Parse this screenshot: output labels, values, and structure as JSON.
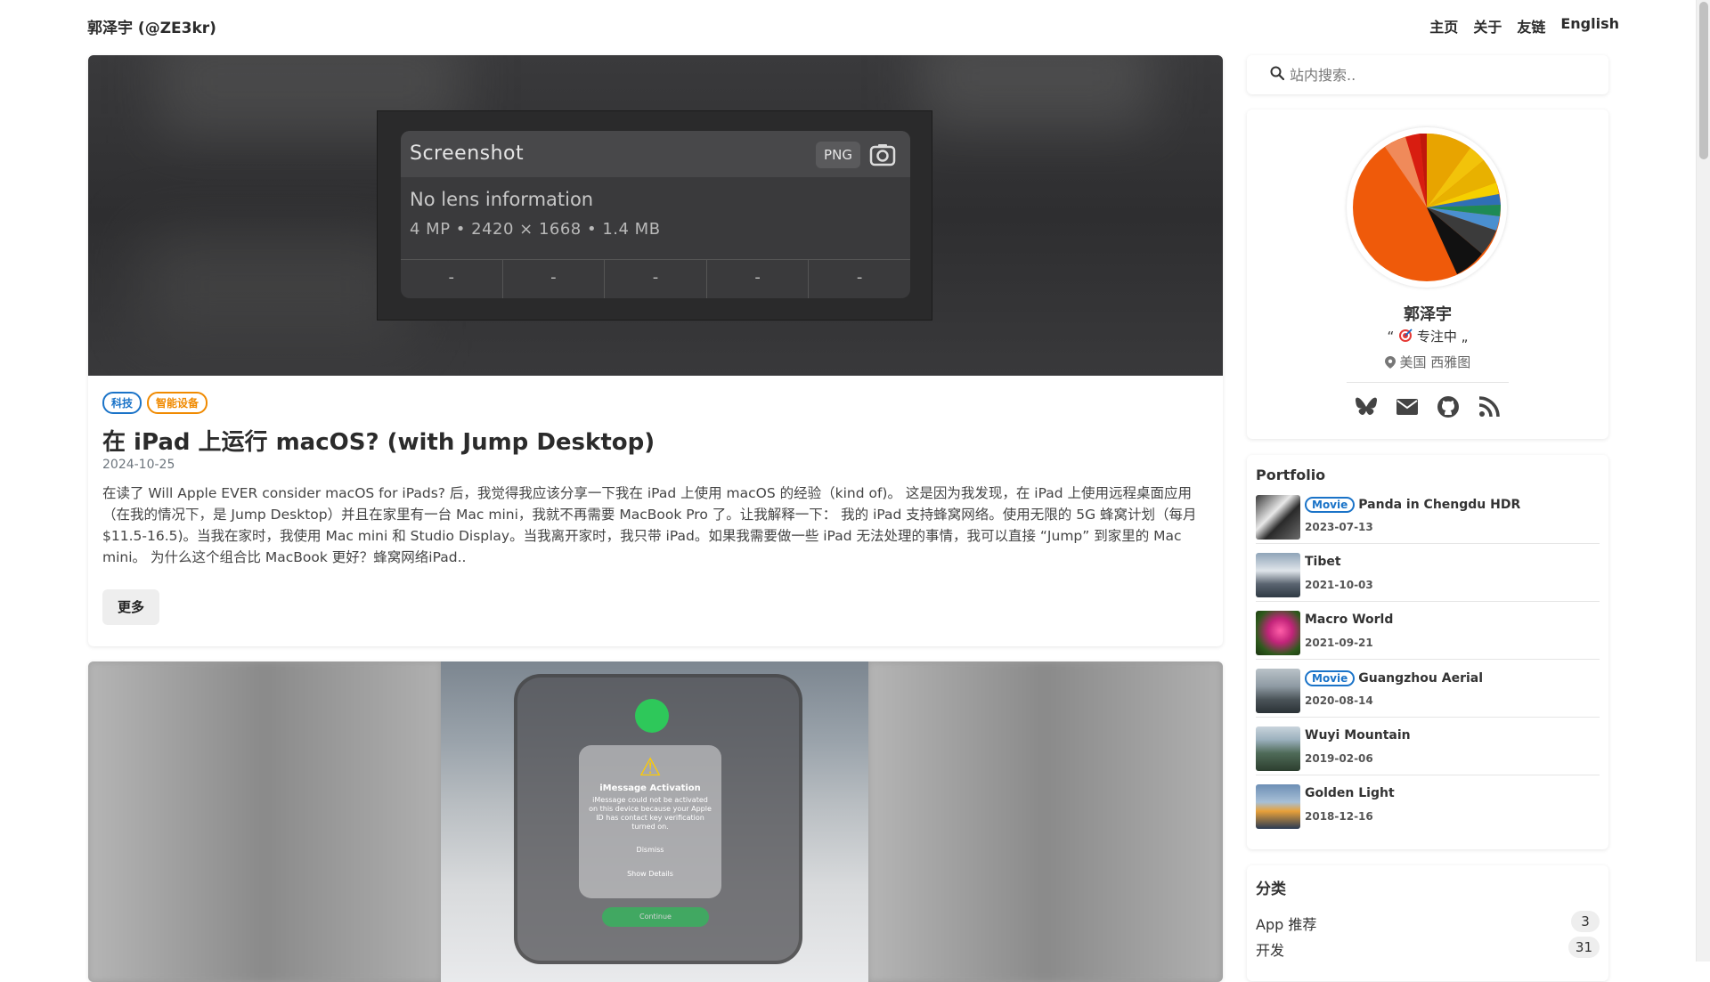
{
  "site": {
    "brand": "郭泽宇 (@ZE3kr)"
  },
  "nav": {
    "items": [
      "主页",
      "关于",
      "友链",
      "English"
    ]
  },
  "posts": [
    {
      "tags": [
        "科技",
        "智能设备"
      ],
      "title": "在 iPad 上运行 macOS? (with Jump Desktop)",
      "date": "2024-10-25",
      "excerpt": "在读了 Will Apple EVER consider macOS for iPads? 后，我觉得我应该分享一下我在 iPad 上使用 macOS 的经验（kind of)。 这是因为我发现，在 iPad 上使用远程桌面应用（在我的情况下，是 Jump Desktop）并且在家里有一台 Mac mini，我就不再需要 MacBook Pro 了。让我解释一下： 我的 iPad 支持蜂窝网络。使用无限的 5G 蜂窝计划（每月 $11.5-16.5)。当我在家时，我使用 Mac mini 和 Studio Display。当我离开家时，我只带 iPad。如果我需要做一些 iPad 无法处理的事情，我可以直接 “Jump” 到家里的 Mac mini。 为什么这个组合比 MacBook 更好？蜂窝网络iPad..",
      "more": "更多",
      "image": {
        "panel_title": "Screenshot",
        "format": "PNG",
        "lens": "No lens information",
        "meta": "4 MP • 2420 × 1668 • 1.4 MB",
        "cells": [
          "-",
          "-",
          "-",
          "-",
          "-"
        ]
      }
    },
    {
      "image": {
        "dialog_title": "iMessage Activation",
        "dialog_body": "iMessage could not be activated on this device because your Apple ID has contact key verification turned on.",
        "dismiss": "Dismiss",
        "details": "Show Details",
        "continue": "Continue"
      }
    }
  ],
  "search": {
    "placeholder": "站内搜索.."
  },
  "profile": {
    "name": "郭泽宇",
    "status_open": "“",
    "status": "专注中",
    "status_close": "„",
    "location": "美国 西雅图",
    "social": [
      "bluesky-icon",
      "mail-icon",
      "github-icon",
      "rss-icon"
    ]
  },
  "portfolio": {
    "title": "Portfolio",
    "items": [
      {
        "badge": "Movie",
        "title": "Panda in Chengdu HDR",
        "date": "2023-07-13"
      },
      {
        "badge": "",
        "title": "Tibet",
        "date": "2021-10-03"
      },
      {
        "badge": "",
        "title": "Macro World",
        "date": "2021-09-21"
      },
      {
        "badge": "Movie",
        "title": "Guangzhou Aerial",
        "date": "2020-08-14"
      },
      {
        "badge": "",
        "title": "Wuyi Mountain",
        "date": "2019-02-06"
      },
      {
        "badge": "",
        "title": "Golden Light",
        "date": "2018-12-16"
      }
    ]
  },
  "categories": {
    "title": "分类",
    "items": [
      {
        "name": "App 推荐",
        "count": "3"
      },
      {
        "name": "开发",
        "count": "31"
      }
    ]
  },
  "colors": {
    "accent_blue": "#1a73c8",
    "accent_orange": "#f08a00"
  }
}
